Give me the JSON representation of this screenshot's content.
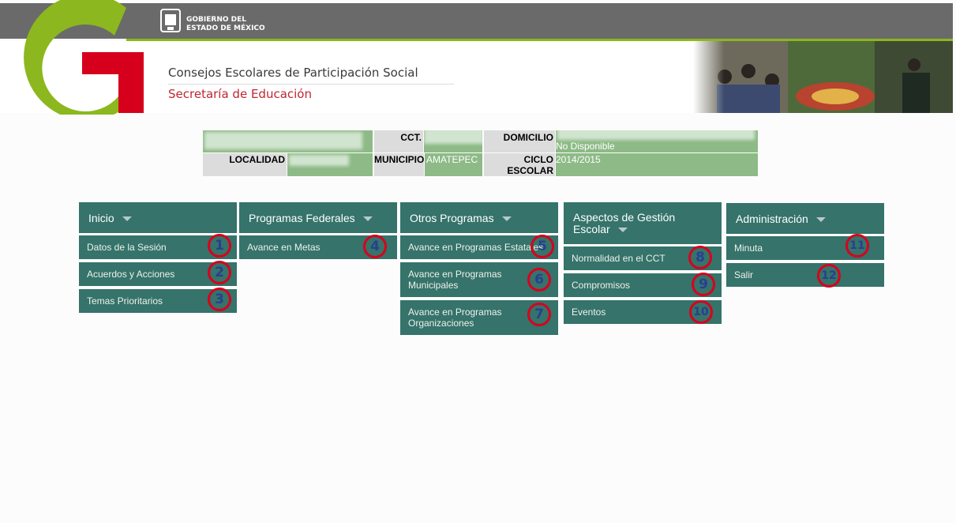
{
  "header": {
    "gov_line1": "GOBIERNO DEL",
    "gov_line2": "ESTADO DE MÉXICO",
    "title": "Consejos Escolares de Participación Social",
    "subtitle": "Secretaría de Educación"
  },
  "info": {
    "cct_label": "CCT.",
    "domicilio_label": "DOMICILIO",
    "domicilio_value": "No Disponible",
    "localidad_label": "LOCALIDAD",
    "municipio_label": "MUNICIPIO",
    "municipio_value": "AMATEPEC",
    "ciclo_label_1": "CICLO",
    "ciclo_label_2": "ESCOLAR",
    "ciclo_value": "2014/2015"
  },
  "menus": {
    "inicio": {
      "title": "Inicio",
      "items": [
        "Datos de la Sesión",
        "Acuerdos y Acciones",
        "Temas Prioritarios"
      ]
    },
    "federales": {
      "title": "Programas Federales",
      "items": [
        "Avance en Metas"
      ]
    },
    "otros": {
      "title": "Otros Programas",
      "items": [
        "Avance en Programas Estatales",
        "Avance en Programas Municipales",
        "Avance en Programas Organizaciones"
      ]
    },
    "gestion": {
      "title_1": "Aspectos de Gestión",
      "title_2": "Escolar",
      "items": [
        "Normalidad en el CCT",
        "Compromisos",
        "Eventos"
      ]
    },
    "admin": {
      "title": "Administración",
      "items": [
        "Minuta",
        "Salir"
      ]
    }
  },
  "badges": [
    "1",
    "2",
    "3",
    "4",
    "5",
    "6",
    "7",
    "8",
    "9",
    "10",
    "11",
    "12"
  ],
  "colors": {
    "menu_bg": "#35736b",
    "value_bg": "#8dba86",
    "badge_ring": "#d8001c",
    "accent_green": "#8db71e",
    "brand_red": "#d6001c"
  }
}
